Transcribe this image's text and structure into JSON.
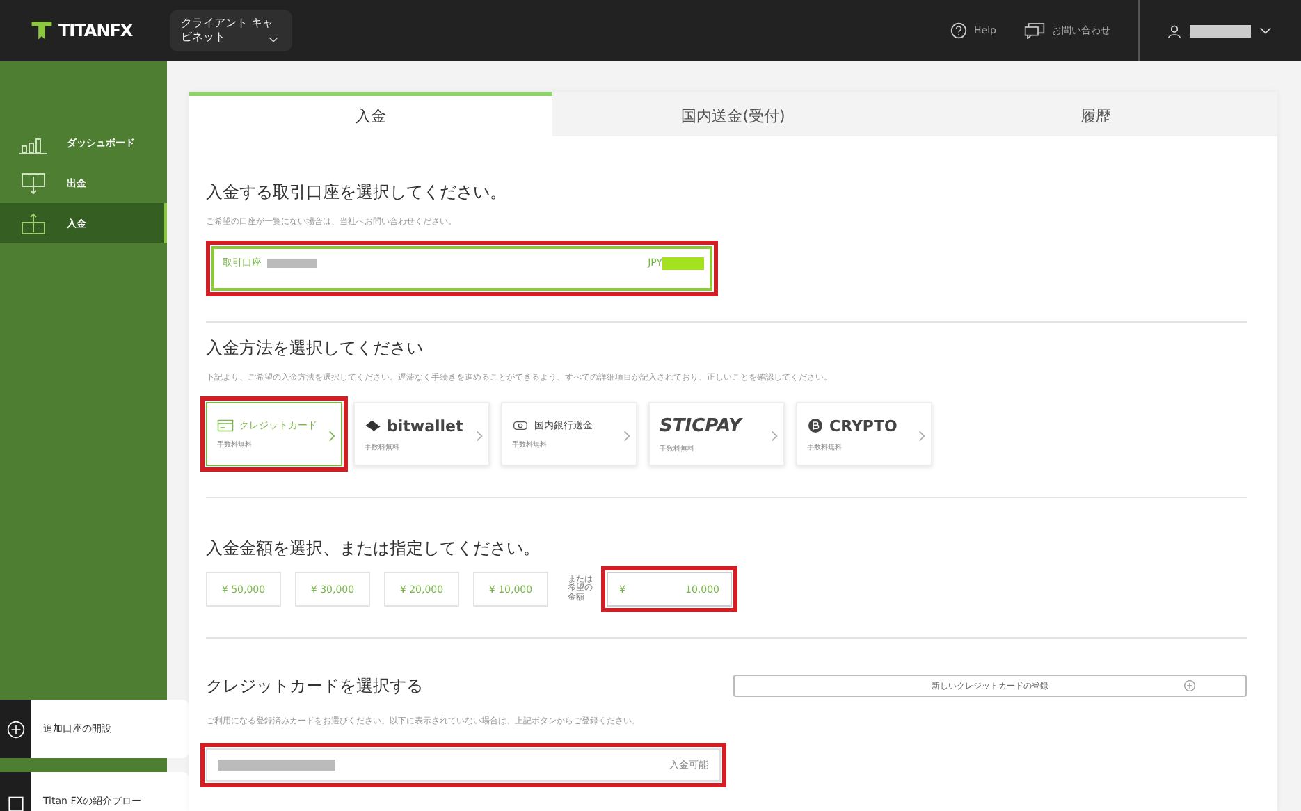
{
  "header": {
    "logo": "TITANFX",
    "cabinet_menu": "クライアント キャビネット",
    "help": "Help",
    "contact": "お問い合わせ"
  },
  "sidebar": {
    "items": [
      {
        "label": "ダッシュボード",
        "selected": false
      },
      {
        "label": "出金",
        "selected": false
      },
      {
        "label": "入金",
        "selected": true
      }
    ],
    "promos": [
      {
        "label": "追加口座の開設"
      },
      {
        "label": "Titan FXの紹介プロー"
      }
    ]
  },
  "tabs": [
    {
      "label": "入金",
      "selected": true
    },
    {
      "label": "国内送金(受付)",
      "selected": false
    },
    {
      "label": "履歴",
      "selected": false
    }
  ],
  "account_section": {
    "title": "入金する取引口座を選択してください。",
    "hint": "ご希望の口座が一覧にない場合は、当社へお問い合わせください。",
    "account_label": "取引口座",
    "currency": "JPY",
    "highlighted": true
  },
  "method_section": {
    "title": "入金方法を選択してください",
    "hint": "下記より、ご希望の入金方法を選択してください。遅滞なく手続きを進めることができるよう、すべての詳細項目が記入されており、正しいことを確認してください。",
    "methods": [
      {
        "kind": "card",
        "label": "クレジットカード",
        "fee": "手数料無料",
        "selected": true,
        "highlighted": true
      },
      {
        "kind": "bitwallet",
        "label": "bitwallet",
        "fee": "手数料無料",
        "selected": false,
        "highlighted": false
      },
      {
        "kind": "bank",
        "label": "国内銀行送金",
        "fee": "手数料無料",
        "selected": false,
        "highlighted": false
      },
      {
        "kind": "sticpay",
        "label": "STICPAY",
        "fee": "手数料無料",
        "selected": false,
        "highlighted": false
      },
      {
        "kind": "crypto",
        "label": "CRYPTO",
        "fee": "手数料無料",
        "selected": false,
        "highlighted": false
      }
    ]
  },
  "amount_section": {
    "title": "入金金額を選択、または指定してください。",
    "presets": [
      "¥ 50,000",
      "¥ 30,000",
      "¥ 20,000",
      "¥ 10,000"
    ],
    "custom_label": "または希望の金額",
    "custom_currency": "¥",
    "custom_value": "10,000",
    "highlighted": true
  },
  "card_section": {
    "title": "クレジットカードを選択する",
    "new_card_button": "新しいクレジットカードの登録",
    "hint": "ご利用になる登録済みカードをお選びください。以下に表示されていない場合は、上記ボタンからご登録ください。",
    "card_status": "入金可能",
    "highlighted": true
  }
}
